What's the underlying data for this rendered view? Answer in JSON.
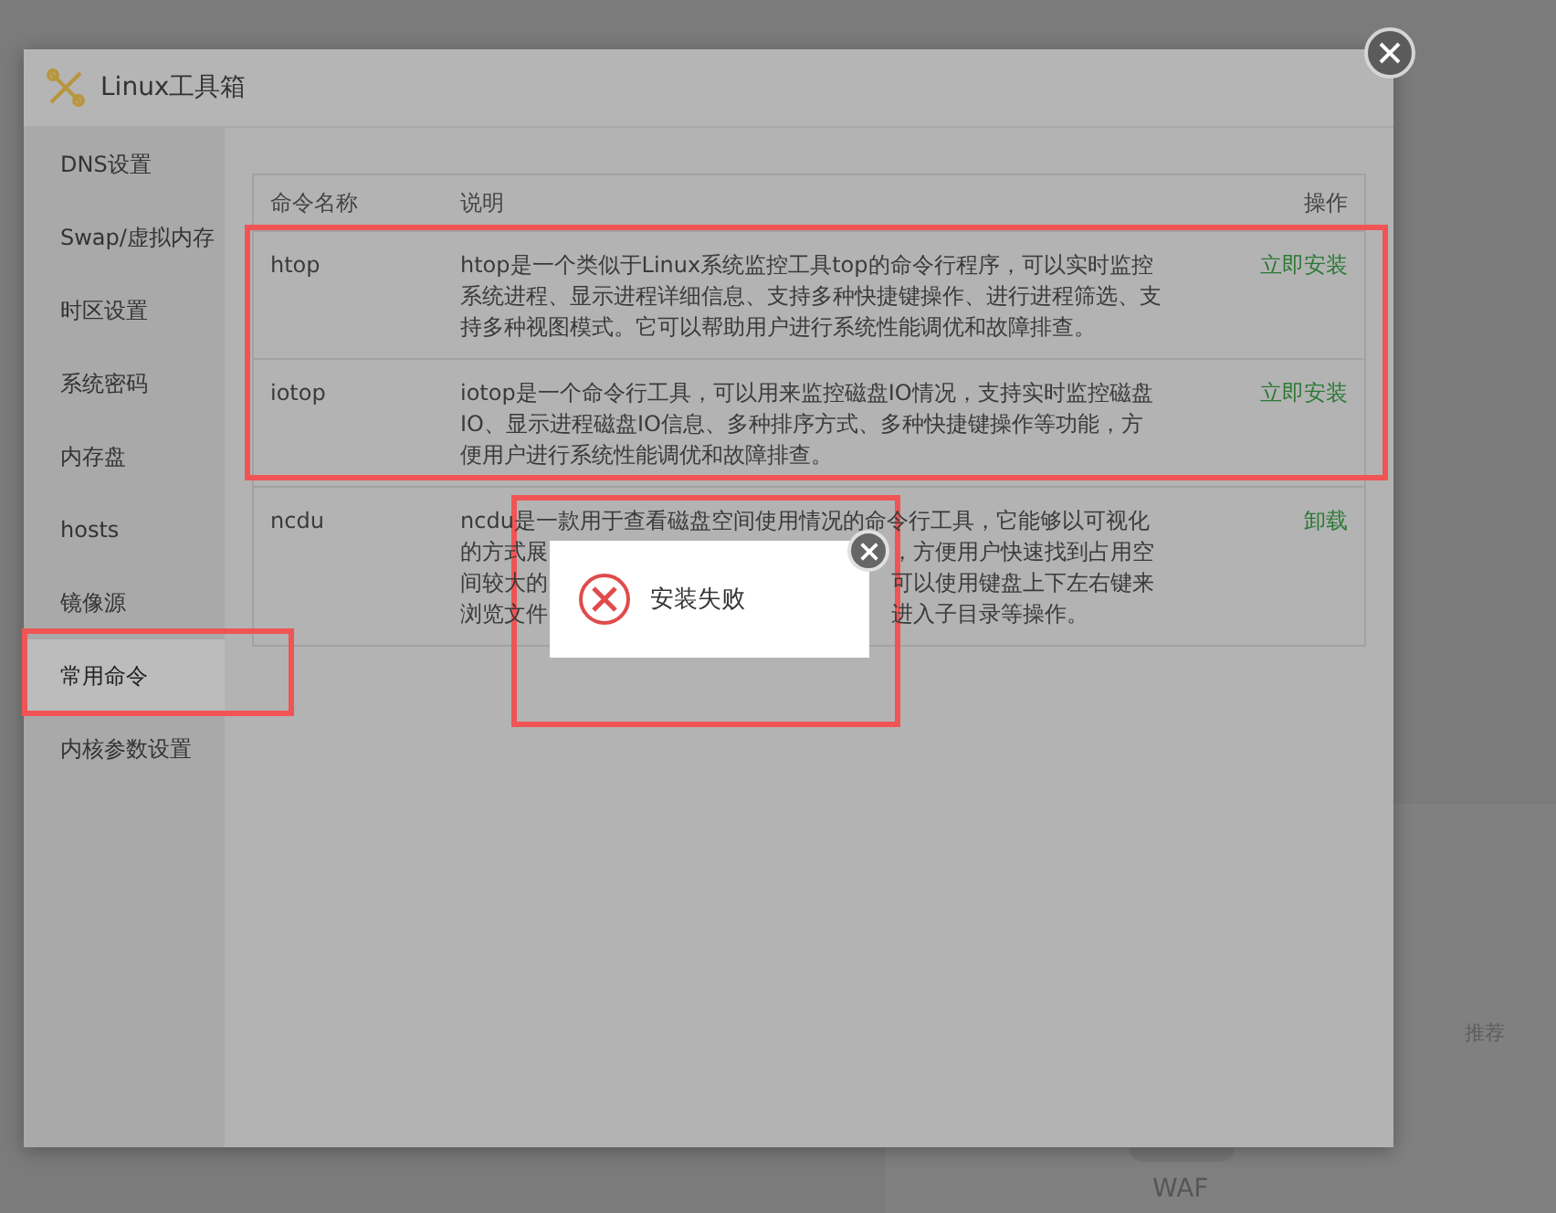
{
  "background": {
    "badge": "推荐",
    "app_label": "WAF"
  },
  "dialog": {
    "title": "Linux工具箱",
    "sidebar": {
      "highlight_frame": true,
      "items": [
        {
          "label": "DNS设置",
          "selected": false
        },
        {
          "label": "Swap/虚拟内存",
          "selected": false
        },
        {
          "label": "时区设置",
          "selected": false
        },
        {
          "label": "系统密码",
          "selected": false
        },
        {
          "label": "内存盘",
          "selected": false
        },
        {
          "label": "hosts",
          "selected": false
        },
        {
          "label": "镜像源",
          "selected": false
        },
        {
          "label": "常用命令",
          "selected": true
        },
        {
          "label": "内核参数设置",
          "selected": false
        }
      ]
    },
    "table": {
      "highlight_frame": true,
      "columns": [
        "命令名称",
        "说明",
        "操作"
      ],
      "rows": [
        {
          "name": "htop",
          "description_lines": [
            [
              "htop是一个类似于Linux系统监控工具top的命令行程序，可以实时监控"
            ],
            [
              "系统进程、显示进程详细信息、支持多种快捷键操作、进行进程筛选、支"
            ],
            [
              "持多种视图模式。它可以帮助用户进行系统性能调优和故障排查。"
            ]
          ],
          "action": "立即安装"
        },
        {
          "name": "iotop",
          "description_lines": [
            [
              "iotop是一个命令行工具，可以用来监控磁盘IO情况，支持实时监控磁盘"
            ],
            [
              "IO、显示进程磁盘IO信息、多种排序方式、多种快捷键操作等功能，方"
            ],
            [
              "便用户进行系统性能调优和故障排查。"
            ]
          ],
          "action": "立即安装"
        },
        {
          "name": "ncdu",
          "description_lines": [
            [
              "ncdu是一款用于查看磁盘空间使用情况的命令行工具，它能够以可视化"
            ],
            [
              "的方式展",
              "，方便用户快速找到占用空"
            ],
            [
              "间较大的",
              "可以使用键盘上下左右键来"
            ],
            [
              "浏览文件",
              "进入子目录等操作。"
            ]
          ],
          "action": "卸载"
        }
      ]
    }
  },
  "toast": {
    "message": "安装失败",
    "highlight_frame": true
  }
}
